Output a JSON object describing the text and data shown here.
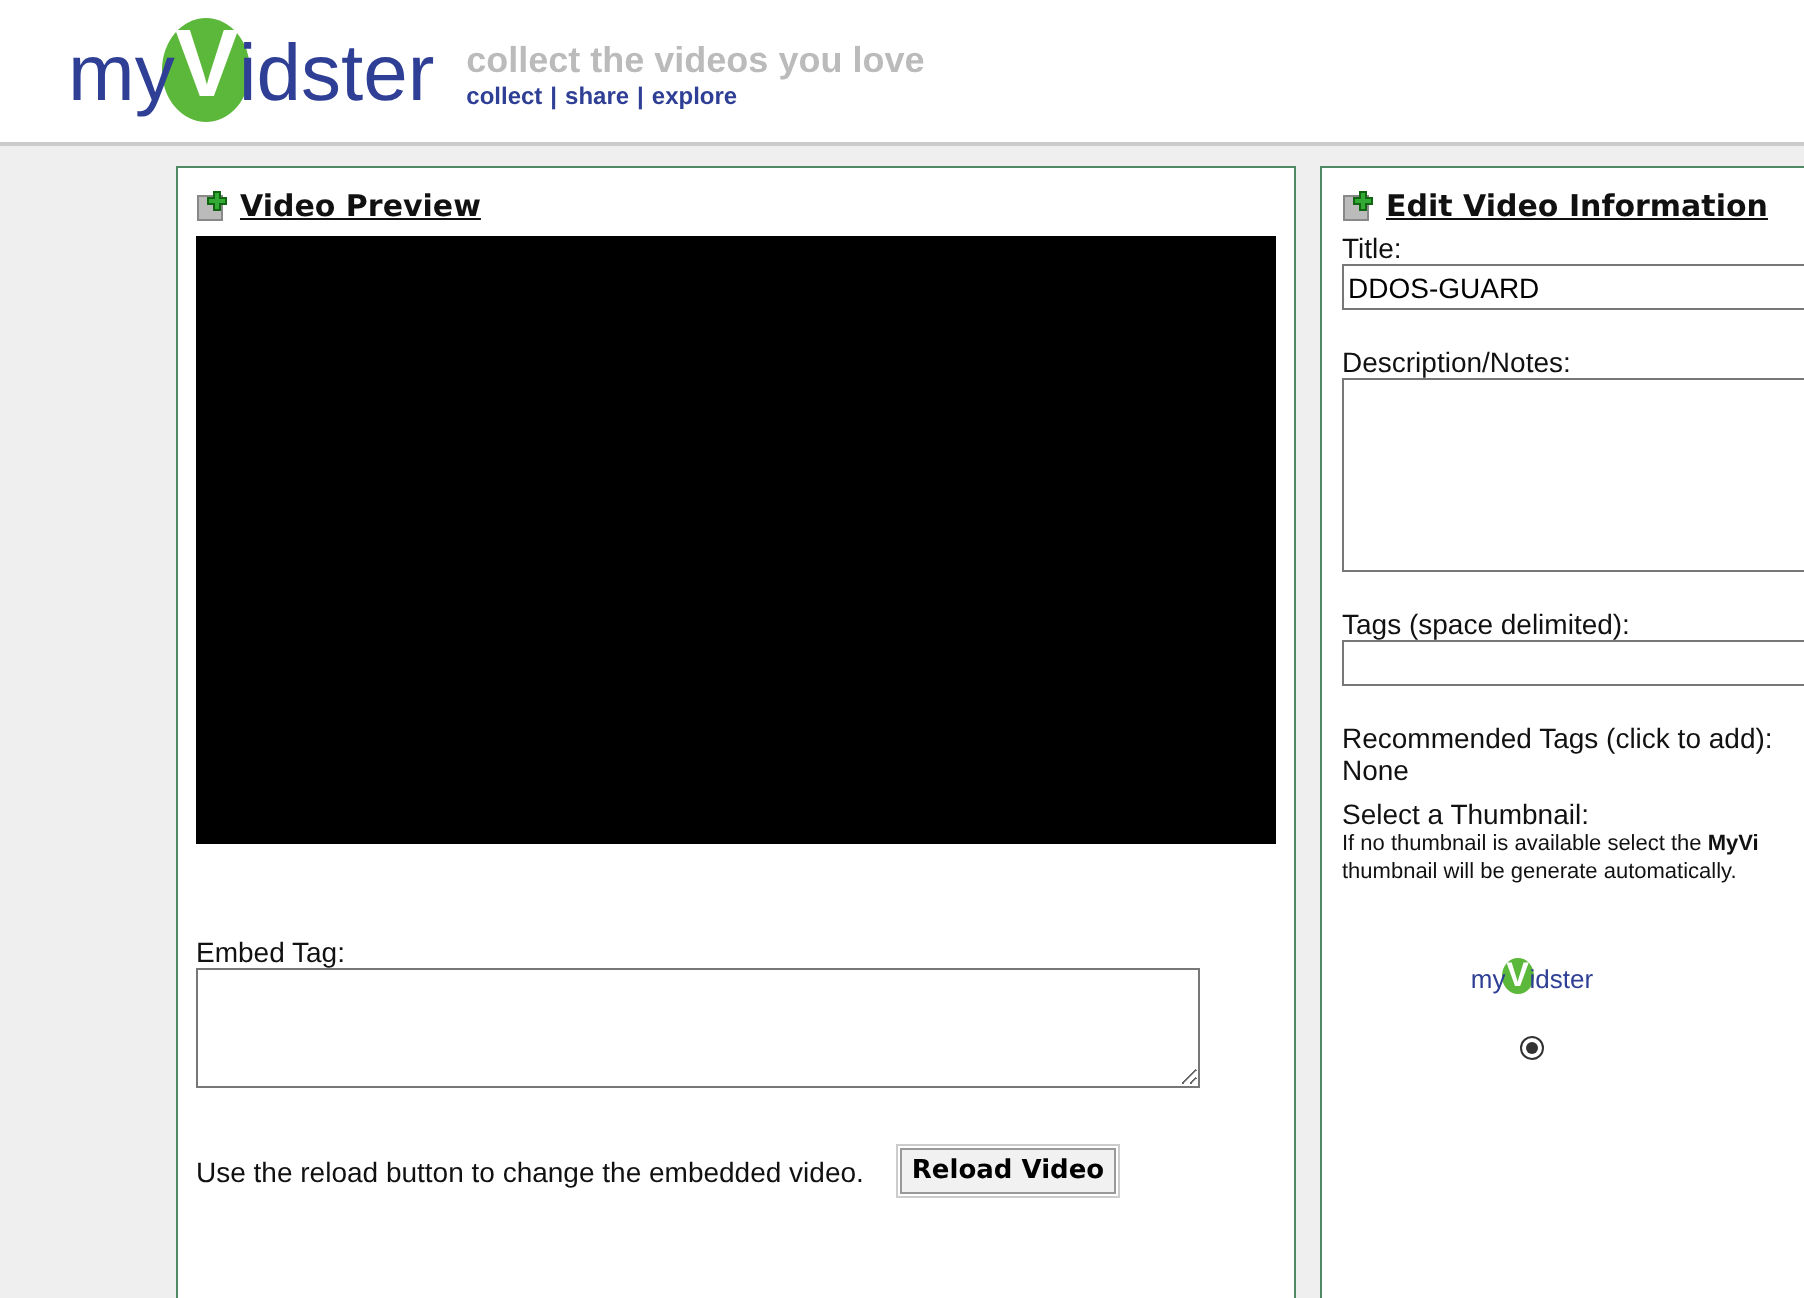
{
  "header": {
    "logo": {
      "prefix": "my",
      "letter": "V",
      "suffix": "idster"
    },
    "tagline": "collect the videos you love",
    "nav": [
      "collect",
      "share",
      "explore"
    ],
    "nav_separator": "|"
  },
  "video_preview": {
    "title": "Video Preview",
    "embed_label": "Embed Tag:",
    "reload_hint": "Use the reload button to change the embedded video.",
    "reload_button": "Reload Video"
  },
  "edit_info": {
    "title": "Edit Video Information",
    "title_label": "Title:",
    "title_value": "DDOS-GUARD",
    "description_label": "Description/Notes:",
    "tags_label": "Tags (space delimited):",
    "recommended_label": "Recommended Tags (click to add):",
    "recommended_value": "None",
    "thumbnail_label": "Select a Thumbnail:",
    "thumbnail_help": [
      "If no thumbnail is available select the **MyVi**",
      "thumbnail will be generate automatically."
    ],
    "thumbnails": [
      {
        "logo": {
          "prefix": "my",
          "letter": "V",
          "suffix": "idster"
        },
        "selected": true
      }
    ]
  }
}
